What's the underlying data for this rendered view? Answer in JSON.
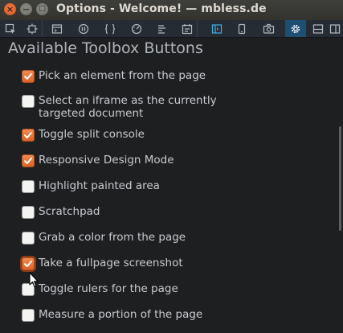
{
  "window": {
    "title": "Options - Welcome! — mbless.de",
    "close_glyph": "×",
    "minimize_glyph": "−",
    "maximize_glyph": "□"
  },
  "toolbar": {
    "buttons": [
      {
        "name": "pick-element-icon"
      },
      {
        "name": "responsive-mode-icon"
      },
      {
        "name": "console-icon"
      },
      {
        "name": "debugger-icon"
      },
      {
        "name": "style-editor-icon"
      },
      {
        "name": "performance-icon"
      },
      {
        "name": "network-icon"
      },
      {
        "name": "storage-icon"
      },
      {
        "name": "split-console-icon"
      },
      {
        "name": "responsive-design-icon"
      },
      {
        "name": "screenshot-icon"
      },
      {
        "name": "options-gear-icon"
      },
      {
        "name": "dock-bottom-icon"
      },
      {
        "name": "dock-side-icon"
      },
      {
        "name": "close-toolbox-icon"
      }
    ],
    "active_index": 11,
    "colors": {
      "accent": "#46afe3",
      "active_bg": "#1d4f73"
    }
  },
  "section": {
    "heading": "Available Toolbox Buttons"
  },
  "options": [
    {
      "label_lines": [
        "Pick an element from the page"
      ],
      "checked": true
    },
    {
      "label_lines": [
        "Select an iframe as the currently",
        "targeted document"
      ],
      "checked": false
    },
    {
      "label_lines": [
        "Toggle split console"
      ],
      "checked": true
    },
    {
      "label_lines": [
        "Responsive Design Mode"
      ],
      "checked": true
    },
    {
      "label_lines": [
        "Highlight painted area"
      ],
      "checked": false
    },
    {
      "label_lines": [
        "Scratchpad"
      ],
      "checked": false
    },
    {
      "label_lines": [
        "Grab a color from the page"
      ],
      "checked": false
    },
    {
      "label_lines": [
        "Take a fullpage screenshot"
      ],
      "checked": true,
      "focused": true
    },
    {
      "label_lines": [
        "Toggle rulers for the page"
      ],
      "checked": false
    },
    {
      "label_lines": [
        "Measure a portion of the page"
      ],
      "checked": false
    }
  ],
  "colors": {
    "checkbox_on": "#e06f36",
    "text": "#c8ccd0",
    "heading": "#b0b5bb",
    "background": "#1e1f21"
  }
}
